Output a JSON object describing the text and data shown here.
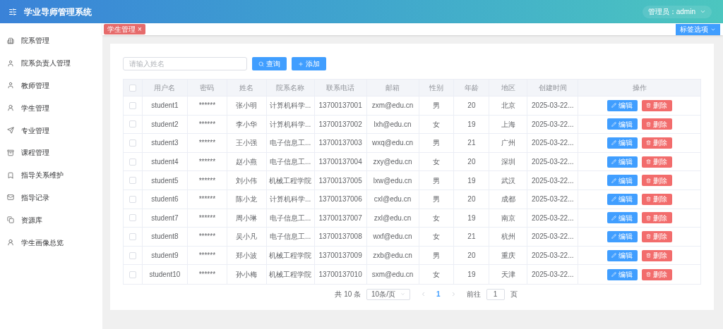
{
  "header": {
    "title": "学业导师管理系统",
    "user": "管理员：admin"
  },
  "sidebar": {
    "items": [
      {
        "label": "院系管理"
      },
      {
        "label": "院系负责人管理"
      },
      {
        "label": "教师管理"
      },
      {
        "label": "学生管理"
      },
      {
        "label": "专业管理"
      },
      {
        "label": "课程管理"
      },
      {
        "label": "指导关系维护"
      },
      {
        "label": "指导记录"
      },
      {
        "label": "资源库"
      },
      {
        "label": "学生画像总览"
      }
    ]
  },
  "tags": [
    {
      "label": "学生管理",
      "close": "×",
      "selected": true
    }
  ],
  "tag_options": "标签选项",
  "search": {
    "placeholder": "请输入姓名"
  },
  "buttons": {
    "query": "查询",
    "add": "添加"
  },
  "table": {
    "all_checked": false,
    "columns": [
      "用户名",
      "密码",
      "姓名",
      "院系名称",
      "联系电话",
      "邮箱",
      "性别",
      "年龄",
      "地区",
      "创建时间",
      "操作"
    ],
    "rows": [
      {
        "checked": false,
        "cells": [
          "student1",
          "******",
          "张小明",
          "计算机科学...",
          "13700137001",
          "zxm@edu.cn",
          "男",
          "20",
          "北京",
          "2025-03-22..."
        ],
        "actions": [
          "编辑",
          "删除"
        ]
      },
      {
        "checked": false,
        "cells": [
          "student2",
          "******",
          "李小华",
          "计算机科学...",
          "13700137002",
          "lxh@edu.cn",
          "女",
          "19",
          "上海",
          "2025-03-22..."
        ],
        "actions": [
          "编辑",
          "删除"
        ]
      },
      {
        "checked": false,
        "cells": [
          "student3",
          "******",
          "王小强",
          "电子信息工...",
          "13700137003",
          "wxq@edu.cn",
          "男",
          "21",
          "广州",
          "2025-03-22..."
        ],
        "actions": [
          "编辑",
          "删除"
        ]
      },
      {
        "checked": false,
        "cells": [
          "student4",
          "******",
          "赵小燕",
          "电子信息工...",
          "13700137004",
          "zxy@edu.cn",
          "女",
          "20",
          "深圳",
          "2025-03-22..."
        ],
        "actions": [
          "编辑",
          "删除"
        ]
      },
      {
        "checked": false,
        "cells": [
          "student5",
          "******",
          "刘小伟",
          "机械工程学院",
          "13700137005",
          "lxw@edu.cn",
          "男",
          "19",
          "武汉",
          "2025-03-22..."
        ],
        "actions": [
          "编辑",
          "删除"
        ]
      },
      {
        "checked": false,
        "cells": [
          "student6",
          "******",
          "陈小龙",
          "计算机科学...",
          "13700137006",
          "cxl@edu.cn",
          "男",
          "20",
          "成都",
          "2025-03-22..."
        ],
        "actions": [
          "编辑",
          "删除"
        ]
      },
      {
        "checked": false,
        "cells": [
          "student7",
          "******",
          "周小琳",
          "电子信息工...",
          "13700137007",
          "zxl@edu.cn",
          "女",
          "19",
          "南京",
          "2025-03-22..."
        ],
        "actions": [
          "编辑",
          "删除"
        ]
      },
      {
        "checked": false,
        "cells": [
          "student8",
          "******",
          "吴小凡",
          "电子信息工...",
          "13700137008",
          "wxf@edu.cn",
          "女",
          "21",
          "杭州",
          "2025-03-22..."
        ],
        "actions": [
          "编辑",
          "删除"
        ]
      },
      {
        "checked": false,
        "cells": [
          "student9",
          "******",
          "郑小波",
          "机械工程学院",
          "13700137009",
          "zxb@edu.cn",
          "男",
          "20",
          "重庆",
          "2025-03-22..."
        ],
        "actions": [
          "编辑",
          "删除"
        ]
      },
      {
        "checked": false,
        "cells": [
          "student10",
          "******",
          "孙小梅",
          "机械工程学院",
          "13700137010",
          "sxm@edu.cn",
          "女",
          "19",
          "天津",
          "2025-03-22..."
        ],
        "actions": [
          "编辑",
          "删除"
        ]
      }
    ]
  },
  "pagination": {
    "total": "共 10 条",
    "page_size": "10条/页",
    "pages": [
      {
        "label": "1",
        "selected": true
      }
    ],
    "goto": "前往",
    "goto_value": "1",
    "page_unit": "页"
  }
}
